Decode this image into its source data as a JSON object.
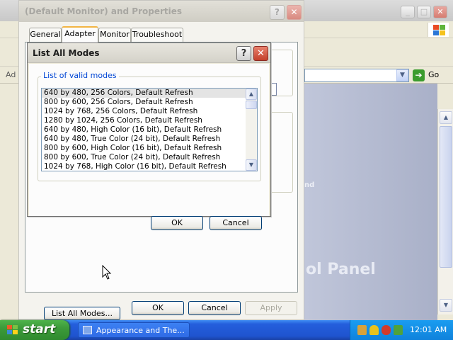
{
  "background_window": {
    "address_label": "Ad",
    "go_label": "Go",
    "content_heading": "ol Panel",
    "content_fragment": "nd"
  },
  "properties_dialog": {
    "title": "(Default Monitor) and  Properties",
    "tabs": [
      {
        "label": "General",
        "active": false
      },
      {
        "label": "Adapter",
        "active": true
      },
      {
        "label": "Monitor",
        "active": false
      },
      {
        "label": "Troubleshoot",
        "active": false
      }
    ],
    "list_all_modes_button": "List All Modes...",
    "ok_label": "OK",
    "cancel_label": "Cancel",
    "apply_label": "Apply",
    "help_glyph": "?",
    "close_glyph": "✕"
  },
  "modes_dialog": {
    "title": "List All Modes",
    "group_label": "List of valid modes",
    "selected_index": 0,
    "modes": [
      "640 by 480, 256 Colors, Default Refresh",
      "800 by 600, 256 Colors, Default Refresh",
      "1024 by 768, 256 Colors, Default Refresh",
      "1280 by 1024, 256 Colors, Default Refresh",
      "640 by 480, High Color (16 bit), Default Refresh",
      "640 by 480, True Color (24 bit), Default Refresh",
      "800 by 600, High Color (16 bit), Default Refresh",
      "800 by 600, True Color (24 bit), Default Refresh",
      "1024 by 768, High Color (16 bit), Default Refresh"
    ],
    "ok_label": "OK",
    "cancel_label": "Cancel",
    "help_glyph": "?",
    "close_glyph": "✕"
  },
  "taskbar": {
    "start_label": "start",
    "task_item_label": "Appearance and The...",
    "clock": "12:01 AM"
  },
  "colors": {
    "taskbar_blue": "#245edc",
    "start_green": "#3c9a3a",
    "link_blue": "#0046d5",
    "close_red": "#c4402a",
    "active_tab_orange": "#f2b544"
  }
}
